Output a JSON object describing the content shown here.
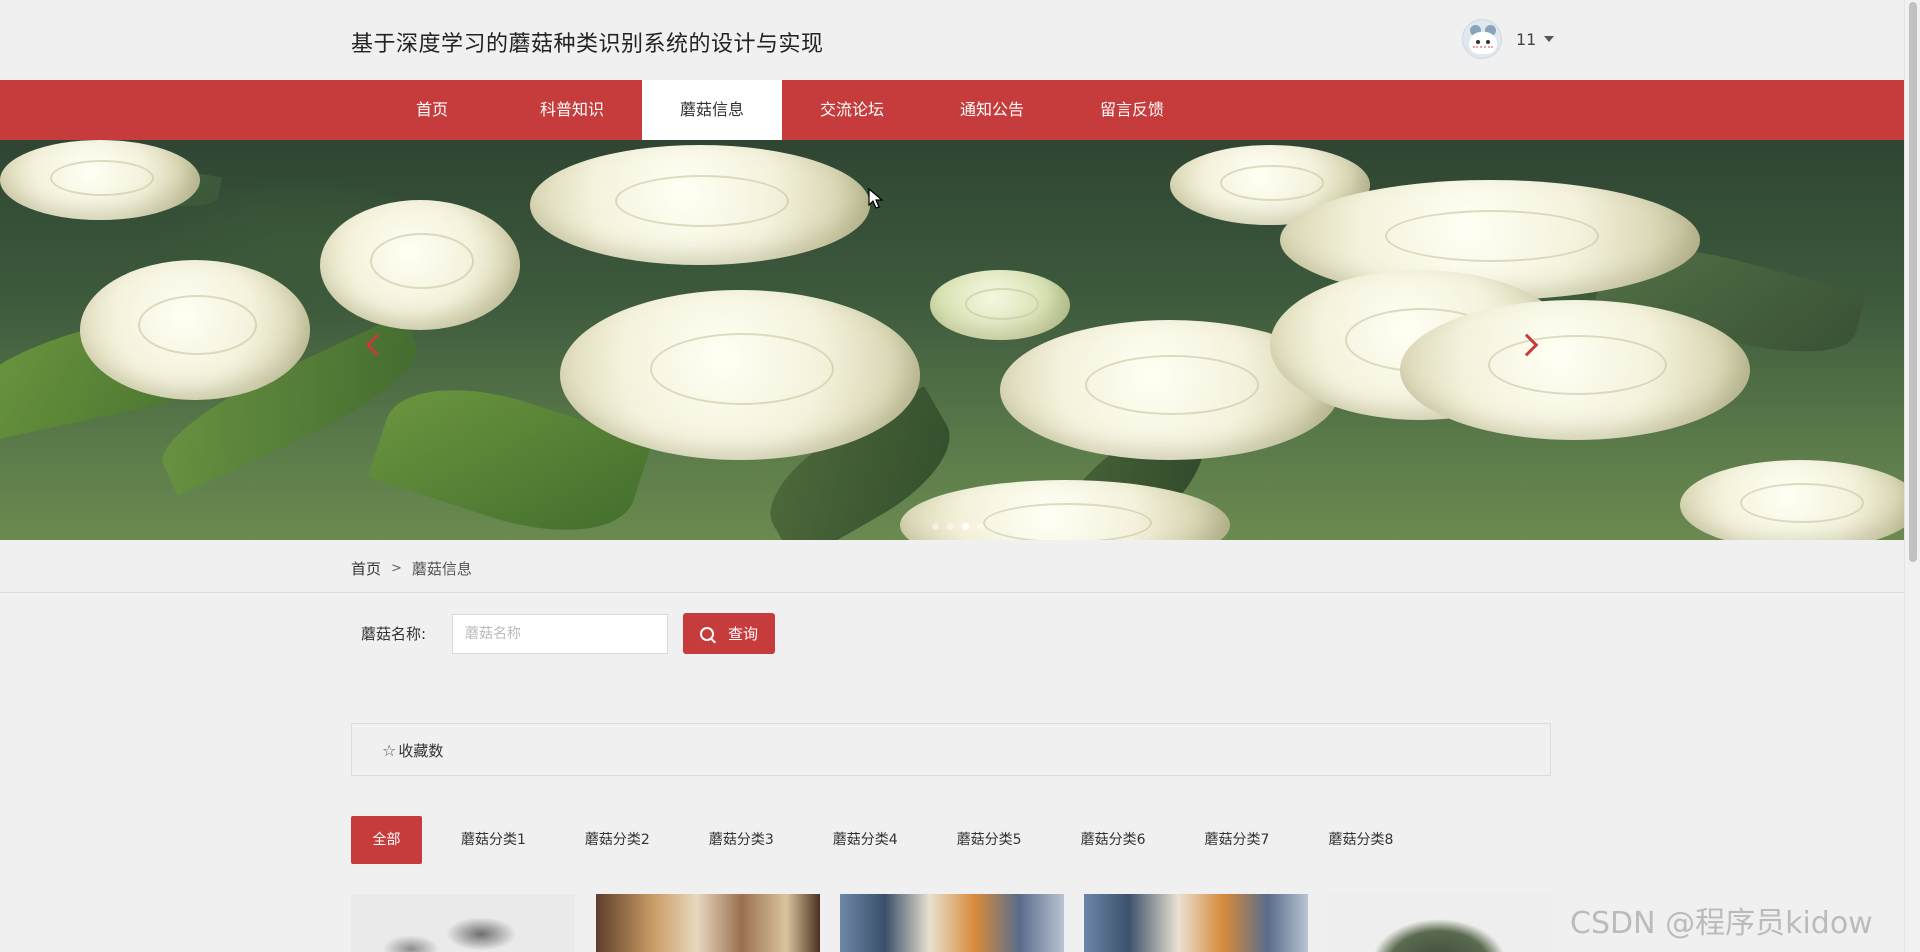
{
  "header": {
    "site_title": "基于深度学习的蘑菇种类识别系统的设计与实现",
    "user": {
      "name": "11"
    }
  },
  "nav": {
    "items": [
      {
        "label": "首页",
        "active": false
      },
      {
        "label": "科普知识",
        "active": false
      },
      {
        "label": "蘑菇信息",
        "active": true
      },
      {
        "label": "交流论坛",
        "active": false
      },
      {
        "label": "通知公告",
        "active": false
      },
      {
        "label": "留言反馈",
        "active": false
      }
    ]
  },
  "banner": {
    "arrow_color": "#c63b3b",
    "dots": 3,
    "active_dot": 2
  },
  "breadcrumb": {
    "home": "首页",
    "separator": ">",
    "current": "蘑菇信息"
  },
  "search": {
    "label": "蘑菇名称:",
    "placeholder": "蘑菇名称",
    "button_label": "查询"
  },
  "sort": {
    "icon": "star-icon",
    "label": "收藏数"
  },
  "categories": {
    "items": [
      "全部",
      "蘑菇分类1",
      "蘑菇分类2",
      "蘑菇分类3",
      "蘑菇分类4",
      "蘑菇分类5",
      "蘑菇分类6",
      "蘑菇分类7",
      "蘑菇分类8"
    ],
    "active_index": 0
  },
  "watermark": "CSDN @程序员kidow",
  "colors": {
    "primary": "#c63b3b",
    "background": "#f1f0f0"
  }
}
